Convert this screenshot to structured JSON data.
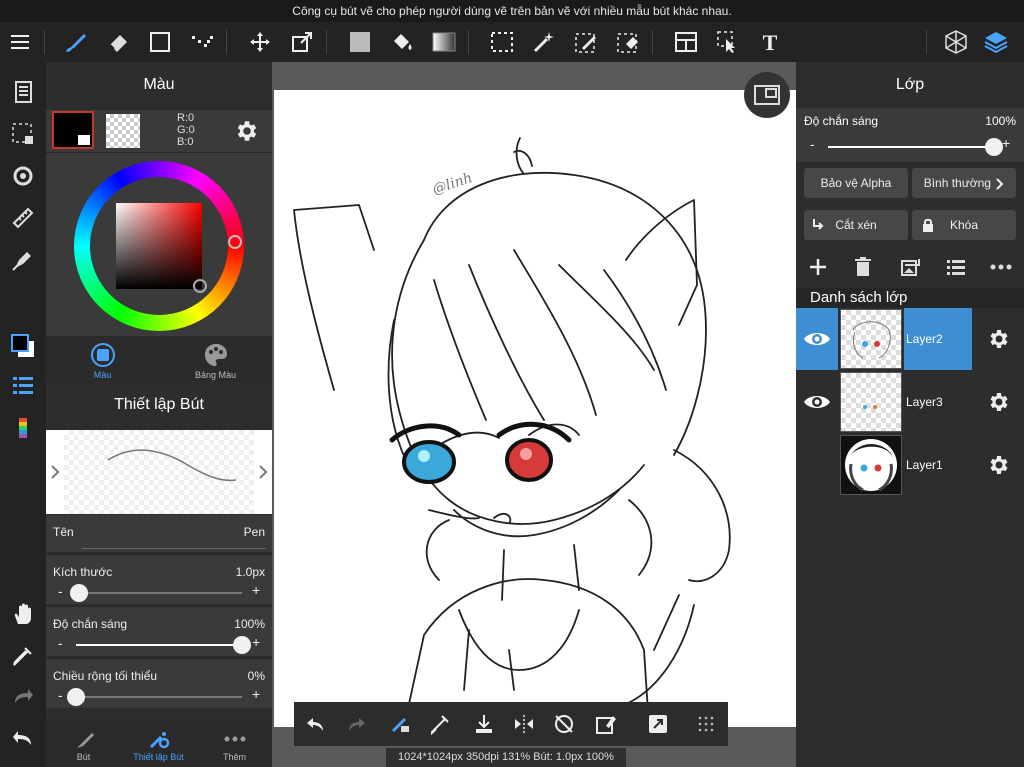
{
  "tooltip": "Công cụ bút vẽ cho phép người dùng vẽ trên bản vẽ với nhiều mẫu bút khác nhau.",
  "colors": {
    "accent": "#3e8ed4",
    "panel": "#2d2d2d",
    "panel_light": "#3a3a3a",
    "selected_swatch_border": "#c0392b"
  },
  "left_panel": {
    "title": "Màu",
    "rgb": {
      "r": "R:0",
      "g": "G:0",
      "b": "B:0"
    },
    "color_tabs": [
      {
        "label": "Màu",
        "active": true
      },
      {
        "label": "Bảng Màu",
        "active": false
      }
    ],
    "brush_settings_title": "Thiết lập Bút",
    "props": {
      "name": {
        "label": "Tên",
        "value": "Pen"
      },
      "size": {
        "label": "Kích thước",
        "value": "1.0px",
        "level": 0.02
      },
      "opacity": {
        "label": "Độ chắn sáng",
        "value": "100%",
        "level": 1.0
      },
      "min_width": {
        "label": "Chiều rộng tối thiểu",
        "value": "0%",
        "level": 0.0
      }
    },
    "bottom_tabs": [
      {
        "label": "Bút",
        "active": false
      },
      {
        "label": "Thiết lập Bút",
        "active": true
      },
      {
        "label": "Thêm",
        "active": false
      }
    ]
  },
  "right_panel": {
    "title": "Lớp",
    "opacity_label": "Độ chắn sáng",
    "opacity_value": "100%",
    "opacity_level": 1.0,
    "alpha_protect": "Bảo vệ Alpha",
    "blend_mode": "Bình thường",
    "clipping": "Cắt xén",
    "lock": "Khóa",
    "list_title": "Danh sách lớp",
    "layers": [
      {
        "name": "Layer2",
        "selected": true,
        "visible": true
      },
      {
        "name": "Layer3",
        "selected": false,
        "visible": true
      },
      {
        "name": "Layer1",
        "selected": false,
        "visible": false
      }
    ]
  },
  "canvas": {
    "signature": "@linh",
    "status": "1024*1024px 350dpi 131% Bút: 1.0px 100%"
  },
  "icons": {
    "toolbar": [
      "menu-icon",
      "brush-icon",
      "eraser-icon",
      "square-icon",
      "dot-pattern-icon",
      "move-icon",
      "transform-icon",
      "fill-color-icon",
      "bucket-icon",
      "gradient-icon",
      "marquee-icon",
      "magic-wand-icon",
      "select-pen-icon",
      "select-eraser-icon",
      "panel-layout-icon",
      "select-arrow-icon",
      "text-icon",
      "3d-cube-icon",
      "layers-icon"
    ],
    "rail": [
      "pages-icon",
      "selection-icon",
      "rotate-icon",
      "ruler-icon",
      "pen-eraser-icon",
      "color-swatch-icon",
      "brush-list-icon",
      "palette-strip-icon",
      "hand-icon",
      "eyedropper-icon",
      "redo-icon",
      "undo-icon"
    ]
  }
}
